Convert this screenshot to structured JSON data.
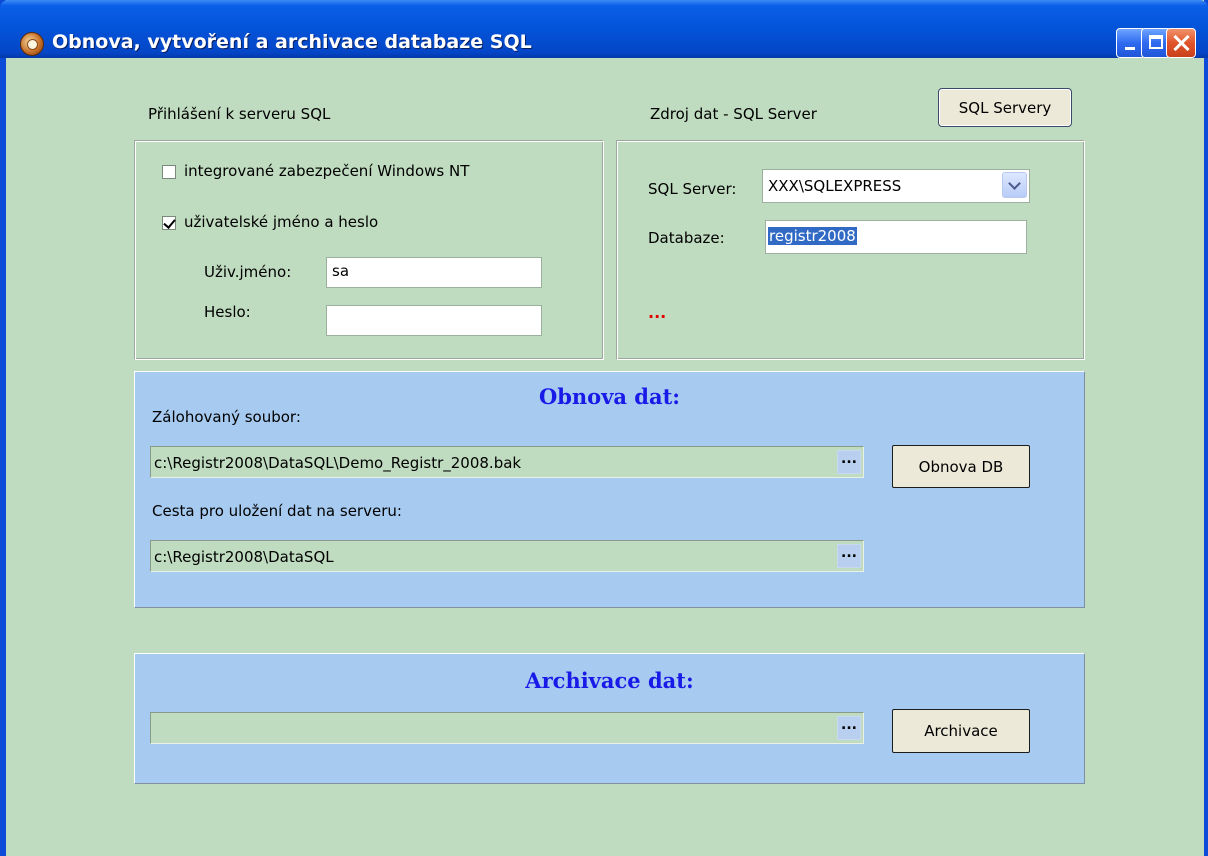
{
  "window": {
    "title": "Obnova, vytvoření a archivace databaze SQL"
  },
  "login": {
    "heading": "Přihlášení k serveru SQL",
    "integrated_label": "integrované zabezpečení  Windows NT",
    "integrated_checked": false,
    "userpass_label": "uživatelské jméno a heslo",
    "userpass_checked": true,
    "username_label": "Uživ.jméno:",
    "username_value": "sa",
    "password_label": "Heslo:",
    "password_value": ""
  },
  "source": {
    "heading": "Zdroj dat - SQL Server",
    "servers_button": "SQL Servery",
    "server_label": "SQL Server:",
    "server_value": "XXX\\SQLEXPRESS",
    "database_label": "Databaze:",
    "database_value": "registr2008",
    "status_dots": "..."
  },
  "restore": {
    "title": "Obnova dat:",
    "backup_file_label": "Zálohovaný soubor:",
    "backup_file_value": "c:\\Registr2008\\DataSQL\\Demo_Registr_2008.bak",
    "browse_label": "...",
    "restore_button": "Obnova DB",
    "server_path_label": "Cesta pro uložení dat na serveru:",
    "server_path_value": "c:\\Registr2008\\DataSQL"
  },
  "archive": {
    "title": "Archivace dat:",
    "path_value": "",
    "browse_label": "...",
    "archive_button": "Archivace"
  },
  "colors": {
    "form_background": "#c0dcc0",
    "panel_background": "#a6caf0",
    "panel_title": "#1a1ae8",
    "titlebar": "#0453d8",
    "status_dots": "#e00000"
  }
}
